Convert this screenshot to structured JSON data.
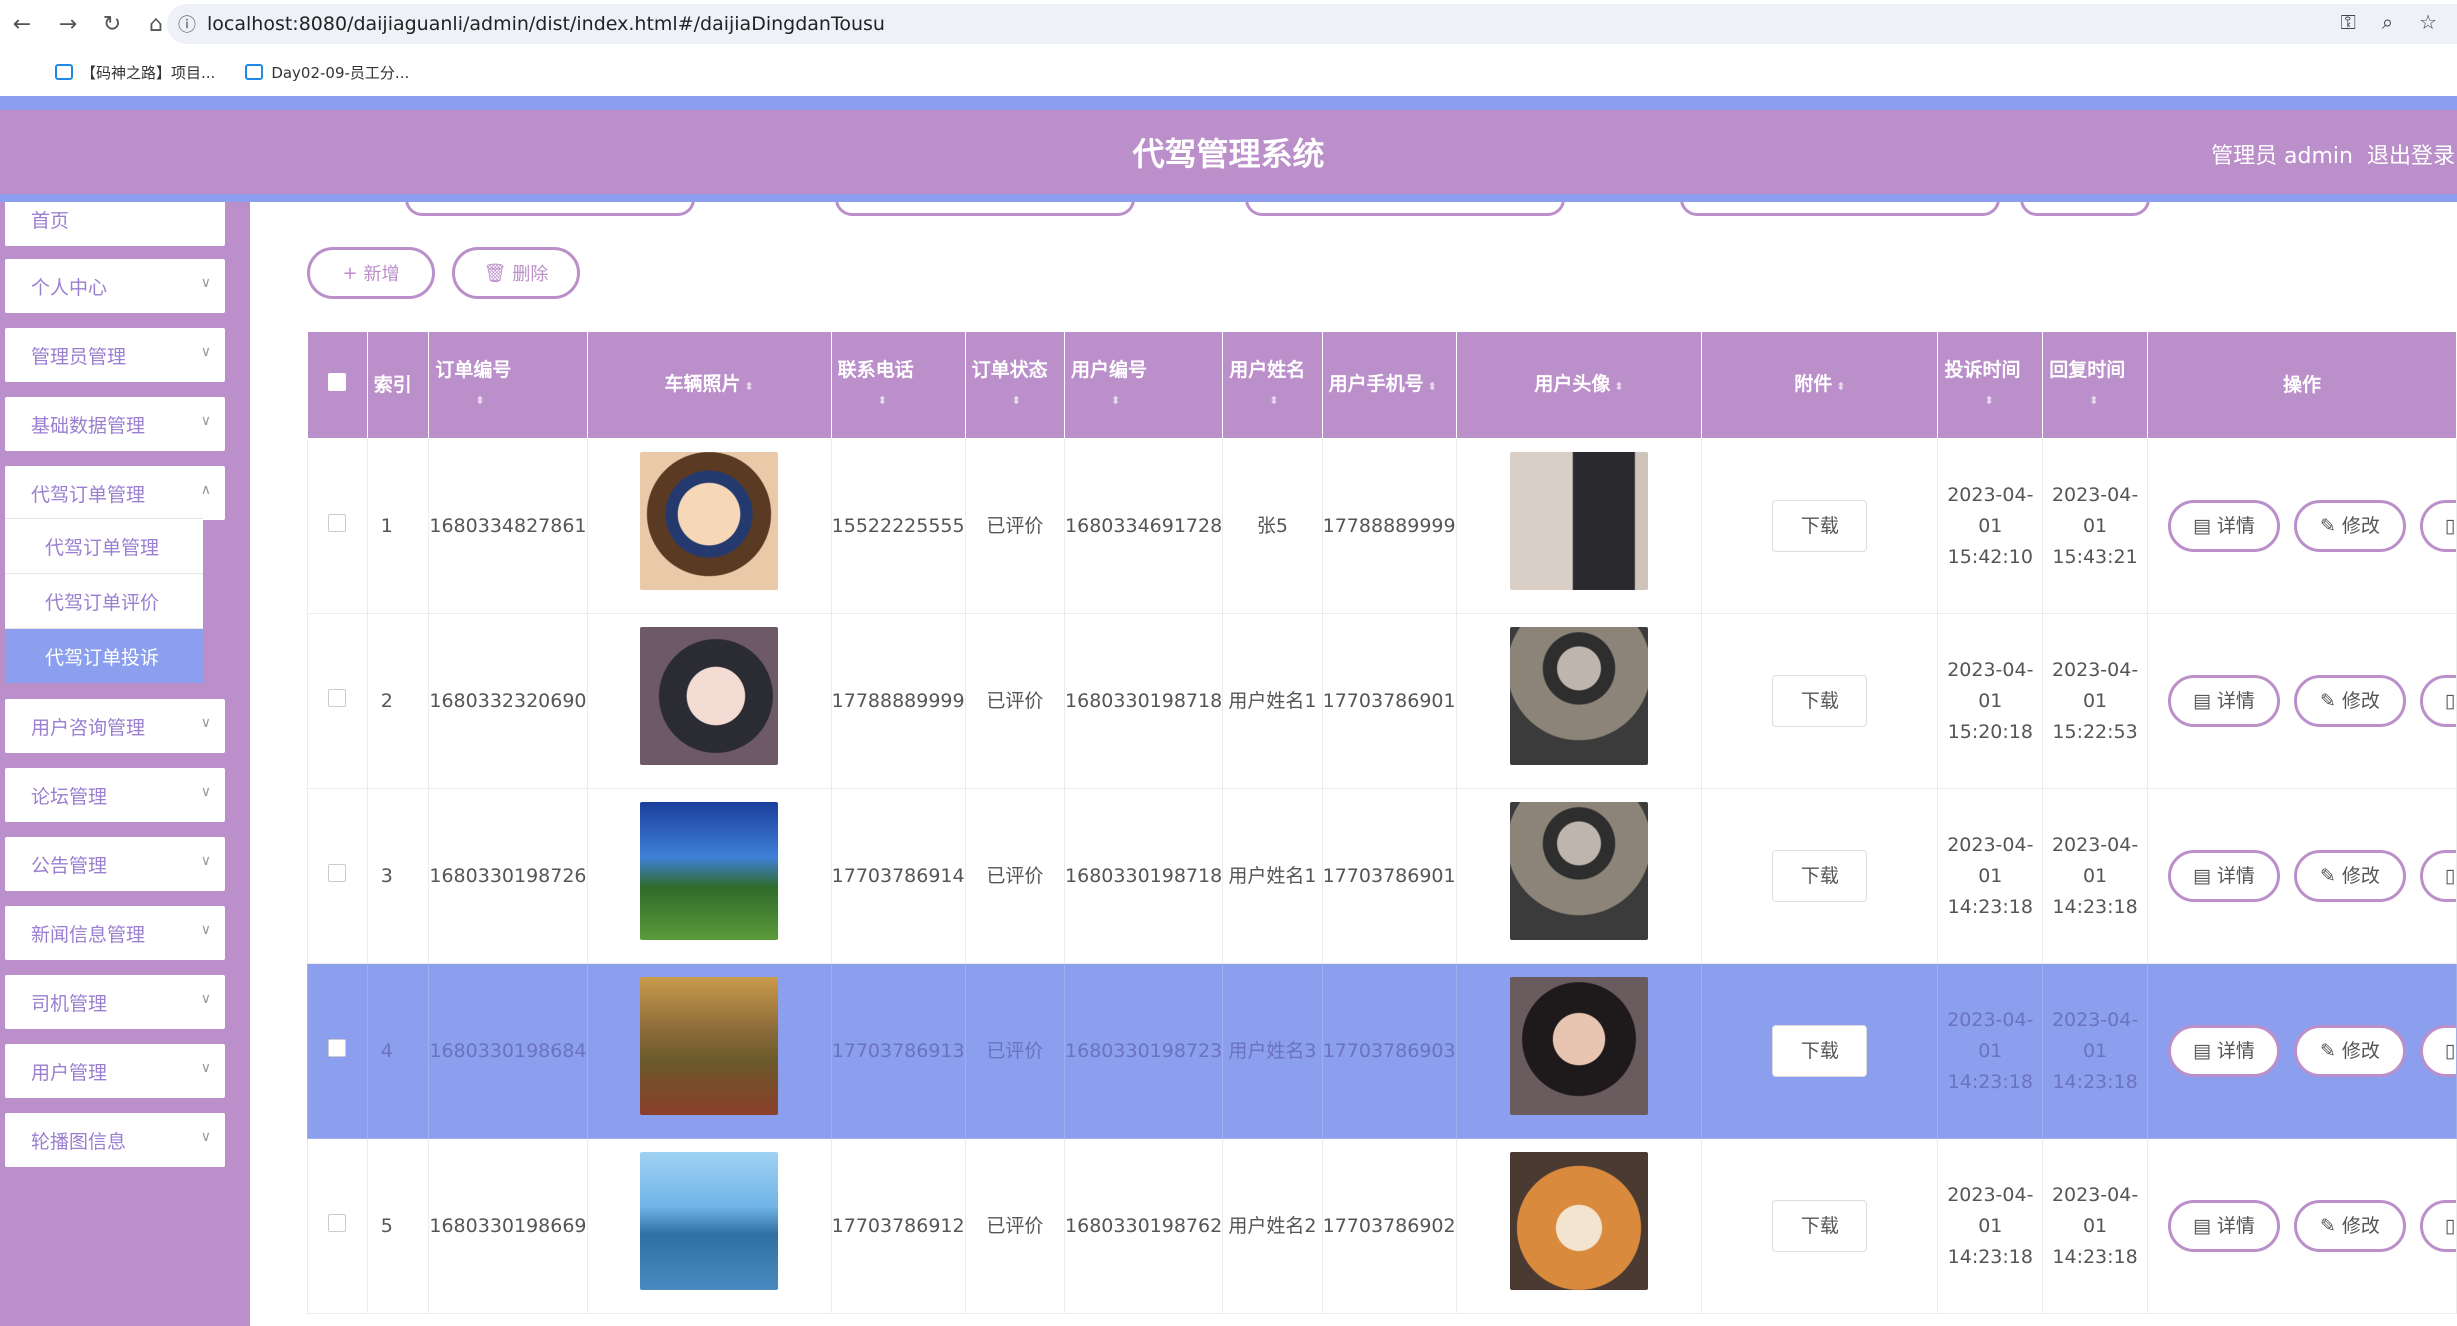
{
  "browser": {
    "url": "localhost:8080/daijiaguanli/admin/dist/index.html#/daijiaDingdanTousu",
    "bookmarks": [
      "【码神之路】项目...",
      "Day02-09-员工分..."
    ]
  },
  "header": {
    "title": "代驾管理系统",
    "user": "管理员 admin",
    "logout": "退出登录"
  },
  "sidebar": {
    "items": [
      {
        "label": "首页"
      },
      {
        "label": "个人中心"
      },
      {
        "label": "管理员管理"
      },
      {
        "label": "基础数据管理"
      },
      {
        "label": "代驾订单管理"
      },
      {
        "label": "用户咨询管理"
      },
      {
        "label": "论坛管理"
      },
      {
        "label": "公告管理"
      },
      {
        "label": "新闻信息管理"
      },
      {
        "label": "司机管理"
      },
      {
        "label": "用户管理"
      },
      {
        "label": "轮播图信息"
      }
    ],
    "submenu": [
      {
        "label": "代驾订单管理"
      },
      {
        "label": "代驾订单评价"
      },
      {
        "label": "代驾订单投诉"
      }
    ]
  },
  "toolbar": {
    "add_label": "新增",
    "delete_label": "删除"
  },
  "table": {
    "headers": [
      "索引",
      "订单编号",
      "车辆照片",
      "联系电话",
      "订单状态",
      "用户编号",
      "用户姓名",
      "用户手机号",
      "用户头像",
      "附件",
      "投诉时间",
      "回复时间",
      "操作"
    ],
    "download_label": "下载",
    "detail_label": "详情",
    "edit_label": "修改",
    "rows": [
      {
        "index": "1",
        "order_no": "1680334827861",
        "phone": "15522225555",
        "status": "已评价",
        "user_no": "1680334691728",
        "user_name": "张5",
        "user_phone": "17788889999",
        "complaint_time": "2023-04-01 15:42:10",
        "reply_time": "2023-04-01 15:43:21"
      },
      {
        "index": "2",
        "order_no": "1680332320690",
        "phone": "17788889999",
        "status": "已评价",
        "user_no": "1680330198718",
        "user_name": "用户姓名1",
        "user_phone": "17703786901",
        "complaint_time": "2023-04-01 15:20:18",
        "reply_time": "2023-04-01 15:22:53"
      },
      {
        "index": "3",
        "order_no": "1680330198726",
        "phone": "17703786914",
        "status": "已评价",
        "user_no": "1680330198718",
        "user_name": "用户姓名1",
        "user_phone": "17703786901",
        "complaint_time": "2023-04-01 14:23:18",
        "reply_time": "2023-04-01 14:23:18"
      },
      {
        "index": "4",
        "order_no": "1680330198684",
        "phone": "17703786913",
        "status": "已评价",
        "user_no": "1680330198723",
        "user_name": "用户姓名3",
        "user_phone": "17703786903",
        "complaint_time": "2023-04-01 14:23:18",
        "reply_time": "2023-04-01 14:23:18"
      },
      {
        "index": "5",
        "order_no": "1680330198669",
        "phone": "17703786912",
        "status": "已评价",
        "user_no": "1680330198762",
        "user_name": "用户姓名2",
        "user_phone": "17703786902",
        "complaint_time": "2023-04-01 14:23:18",
        "reply_time": "2023-04-01 14:23:18"
      }
    ]
  }
}
